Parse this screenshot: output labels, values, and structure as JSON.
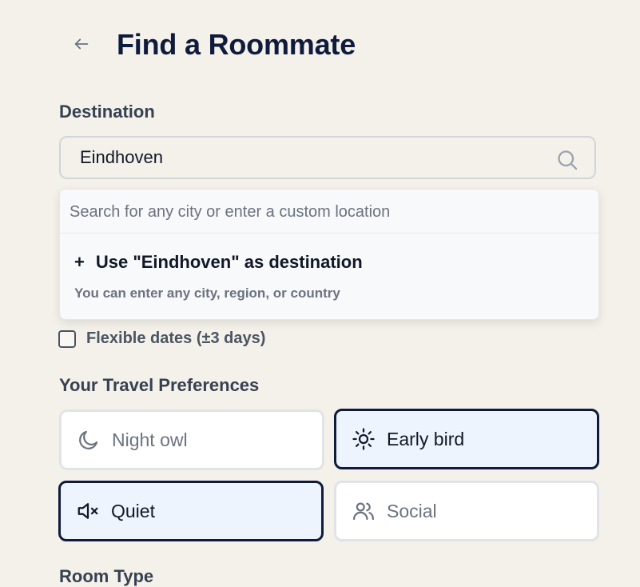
{
  "header": {
    "title": "Find a Roommate"
  },
  "destination": {
    "label": "Destination",
    "value": "Eindhoven"
  },
  "dropdown": {
    "placeholder": "Search for any city or enter a custom location",
    "custom_option": {
      "prefix": "+",
      "label": "Use \"Eindhoven\" as destination",
      "hint": "You can enter any city, region, or country"
    }
  },
  "flexible_dates": {
    "label": "Flexible dates (±3 days)",
    "checked": false
  },
  "preferences": {
    "label": "Your Travel Preferences",
    "options": [
      {
        "label": "Night owl",
        "icon": "moon-icon",
        "selected": false
      },
      {
        "label": "Early bird",
        "icon": "sun-icon",
        "selected": true
      },
      {
        "label": "Quiet",
        "icon": "volume-mute-icon",
        "selected": true
      },
      {
        "label": "Social",
        "icon": "users-icon",
        "selected": false
      }
    ]
  },
  "room_type": {
    "label": "Room Type"
  },
  "colors": {
    "background": "#f4f1ea",
    "title": "#0f1b3d",
    "selected_border": "#0f1b3d",
    "selected_fill": "#eef4fd"
  }
}
